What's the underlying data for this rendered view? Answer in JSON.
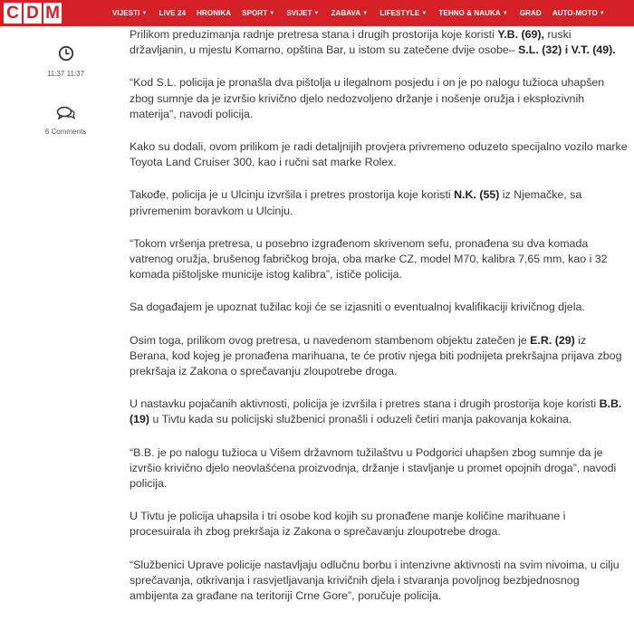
{
  "logo": {
    "letters": [
      "C",
      "D",
      "M"
    ]
  },
  "nav": [
    {
      "label": "VIJESTI",
      "dropdown": true
    },
    {
      "label": "LIVE 24",
      "dropdown": false
    },
    {
      "label": "HRONIKA",
      "dropdown": false
    },
    {
      "label": "SPORT",
      "dropdown": true
    },
    {
      "label": "SVIJET",
      "dropdown": true
    },
    {
      "label": "ZABAVA",
      "dropdown": true
    },
    {
      "label": "LIFESTYLE",
      "dropdown": true
    },
    {
      "label": "TEHNO & NAUKA",
      "dropdown": true
    },
    {
      "label": "GRAD",
      "dropdown": false
    },
    {
      "label": "AUTO-MOTO",
      "dropdown": true
    }
  ],
  "meta": {
    "time": "11:37 11:37",
    "comments": "6 Comments",
    "icons": [
      "clock-icon",
      "comments-icon"
    ]
  },
  "article": {
    "paragraphs": [
      [
        {
          "t": "Prilikom preduzimanja radnje pretresa stana i drugih prostorija koje koristi "
        },
        {
          "t": "Y.B. (69),",
          "b": true
        },
        {
          "t": " ruski državljanin, u mjestu Komarno, opština Bar, u istom su zatečene dvije osobe– "
        },
        {
          "t": "S.L. (32) i V.T. (49).",
          "b": true
        }
      ],
      [
        {
          "t": "“Kod S.L. policija je pronašla dva pištolja u ilegalnom posjedu i on je po nalogu tužioca uhapšen zbog sumnje da je izvršio krivično djelo nedozvoljeno držanje i nošenje oružja i eksplozivnih materija”, navodi policija."
        }
      ],
      [
        {
          "t": "Kako su dodali, ovom prilikom je radi detaljnijih provjera privremeno oduzeto specijalno vozilo marke Toyota Land Cruiser 300, kao i ručni sat marke Rolex."
        }
      ],
      [
        {
          "t": "Takođe, policija je u Ulcinju izvršila i pretres prostorija koje koristi "
        },
        {
          "t": "N.K. (55)",
          "b": true
        },
        {
          "t": " iz Njemačke, sa privremenim boravkom u Ulcinju."
        }
      ],
      [
        {
          "t": "“Tokom vršenja pretresa, u posebno izgrađenom skrivenom sefu, pronađena su dva komada vatrenog oružja, brušenog fabričkog broja, oba marke CZ, model M70, kalibra 7,65 mm, kao i 32 komada pištoljske municije istog kalibra”, ističe policija."
        }
      ],
      [
        {
          "t": "Sa događajem je upoznat tužilac koji će se izjasniti o eventualnoj kvalifikaciji krivičnog djela."
        }
      ],
      [
        {
          "t": "Osim toga, prilikom ovog pretresa, u navedenom stambenom objektu zatečen je "
        },
        {
          "t": "E.R. (29)",
          "b": true
        },
        {
          "t": " iz Berana, kod kojeg je pronađena marihuana, te će protiv njega biti podnijeta prekršajna prijava zbog prekršaja iz Zakona o sprečavanju zloupotrebe droga."
        }
      ],
      [
        {
          "t": "U nastavku pojačanih aktivnosti, policija je izvršila i pretres stana i drugih prostorija koje koristi "
        },
        {
          "t": "B.B. (19)",
          "b": true
        },
        {
          "t": " u Tivtu kada su policijski službenici pronašli i oduzeli četiri manja pakovanja kokaina."
        }
      ],
      [
        {
          "t": "“B.B. je po nalogu tužioca u Višem državnom tužilaštvu u Podgorici uhapšen zbog sumnje da je izvršio krivično djelo neovlašćena proizvodnja, držanje i stavljanje u promet opojnih droga”, navodi policija."
        }
      ],
      [
        {
          "t": "U Tivtu je policija uhapsila i tri osobe kod kojih su pronađene manje količine marihuane i procesuirala ih zbog prekršaja iz Zakona o sprečavanju zloupotrebe droga."
        }
      ],
      [
        {
          "t": "“Službenici Uprave policije nastavljaju odlučnu borbu i intenzivne aktivnosti na svim nivoima, u cilju sprečavanja, otkrivanja i rasvjetljavanja krivičnih djela i stvaranja povoljnog bezbjednosnog ambijenta za građane na teritoriji Crne Gore”, poručuje policija."
        }
      ]
    ]
  },
  "colors": {
    "brand": "#d42026",
    "text": "#3a3a3a"
  }
}
